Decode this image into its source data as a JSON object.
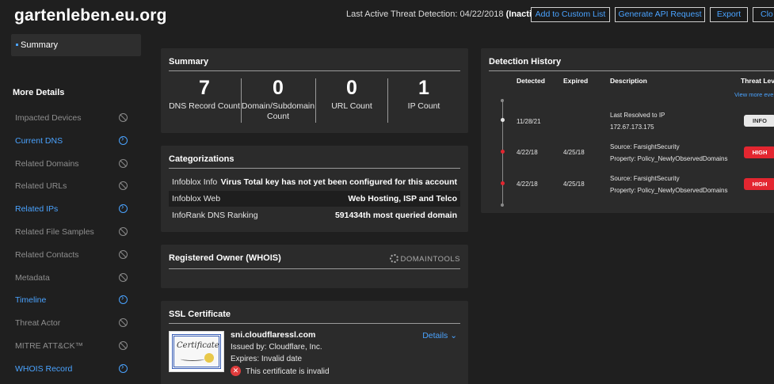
{
  "header": {
    "site_title": "gartenleben.eu.org",
    "last_threat_label": "Last Active Threat Detection: 04/22/2018",
    "last_threat_status": "(Inactive)",
    "buttons": [
      "Add to Custom List",
      "Generate API Request",
      "Export",
      "Clo"
    ]
  },
  "sidebar": {
    "summary_label": "Summary",
    "more_details_label": "More Details",
    "items": [
      {
        "label": "Impacted Devices",
        "state": "disabled"
      },
      {
        "label": "Current DNS",
        "state": "active"
      },
      {
        "label": "Related Domains",
        "state": "disabled"
      },
      {
        "label": "Related URLs",
        "state": "disabled"
      },
      {
        "label": "Related IPs",
        "state": "active"
      },
      {
        "label": "Related File Samples",
        "state": "disabled"
      },
      {
        "label": "Related Contacts",
        "state": "disabled"
      },
      {
        "label": "Metadata",
        "state": "disabled"
      },
      {
        "label": "Timeline",
        "state": "active"
      },
      {
        "label": "Threat Actor",
        "state": "disabled"
      },
      {
        "label": "MITRE ATT&CK™",
        "state": "disabled"
      },
      {
        "label": "WHOIS Record",
        "state": "active"
      }
    ]
  },
  "summary": {
    "title": "Summary",
    "stats": [
      {
        "value": "7",
        "label": "DNS Record Count"
      },
      {
        "value": "0",
        "label": "Domain/Subdomain Count"
      },
      {
        "value": "0",
        "label": "URL Count"
      },
      {
        "value": "1",
        "label": "IP Count"
      }
    ]
  },
  "categorizations": {
    "title": "Categorizations",
    "rows": [
      {
        "key": "Infoblox Info",
        "value": "Virus Total key has not yet been configured for this account"
      },
      {
        "key": "Infoblox Web",
        "value": "Web Hosting, ISP and Telco"
      },
      {
        "key": "InfoRank DNS Ranking",
        "value": "591434th most queried domain"
      }
    ]
  },
  "whois": {
    "title": "Registered Owner (WHOIS)",
    "logo_text": "DOMAINTOOLS"
  },
  "ssl": {
    "title": "SSL Certificate",
    "cert_image_text": "Certificate",
    "domain": "sni.cloudflaressl.com",
    "issued_by": "Issued by: Cloudflare, Inc.",
    "expires": "Expires: Invalid date",
    "invalid_text": "This certificate is invalid",
    "details_label": "Details ⌄"
  },
  "detection_history": {
    "title": "Detection History",
    "columns": [
      "Detected",
      "Expired",
      "Description",
      "Threat Lev"
    ],
    "view_more": "View more eve",
    "rows": [
      {
        "detected": "11/28/21",
        "expired": "",
        "desc1": "Last Resolved to IP",
        "desc2": "172.67.173.175",
        "level": "INFO"
      },
      {
        "detected": "4/22/18",
        "expired": "4/25/18",
        "desc1": "Source: FarsightSecurity",
        "desc2": "Property: Policy_NewlyObservedDomains",
        "level": "HIGH"
      },
      {
        "detected": "4/22/18",
        "expired": "4/25/18",
        "desc1": "Source: FarsightSecurity",
        "desc2": "Property: Policy_NewlyObservedDomains",
        "level": "HIGH"
      }
    ]
  },
  "colors": {
    "accent": "#4aa3ff",
    "background": "#1f1f1f",
    "panel": "#2b2b2b",
    "high": "#e32630",
    "info": "#e8e8e8"
  },
  "icons": {
    "disabled_nav": "ban-icon",
    "active_nav": "chevron-right-circle-icon",
    "ssl_invalid": "error-x-icon",
    "whois_logo": "domaintools-logo"
  }
}
